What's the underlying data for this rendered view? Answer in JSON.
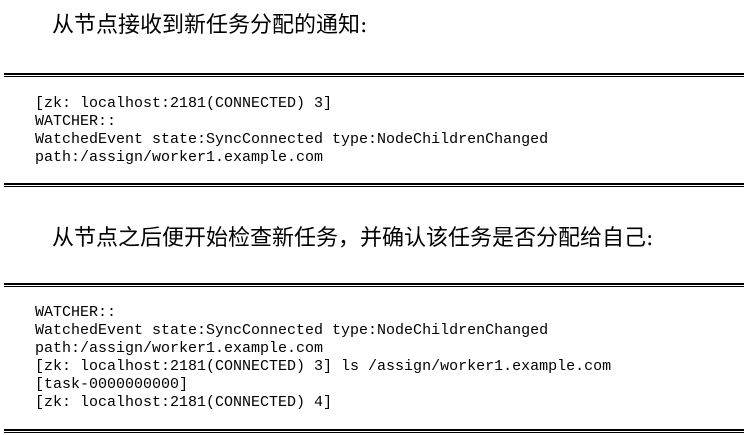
{
  "section1": {
    "text": "从节点接收到新任务分配的通知:",
    "code_lines": [
      "[zk: localhost:2181(CONNECTED) 3]",
      "WATCHER::",
      "WatchedEvent state:SyncConnected type:NodeChildrenChanged",
      "path:/assign/worker1.example.com"
    ]
  },
  "section2": {
    "text": "从节点之后便开始检查新任务，并确认该任务是否分配给自己:",
    "code_lines": [
      "WATCHER::",
      "WatchedEvent state:SyncConnected type:NodeChildrenChanged",
      "path:/assign/worker1.example.com",
      "[zk: localhost:2181(CONNECTED) 3] ls /assign/worker1.example.com",
      "[task-0000000000]",
      "[zk: localhost:2181(CONNECTED) 4]"
    ]
  }
}
